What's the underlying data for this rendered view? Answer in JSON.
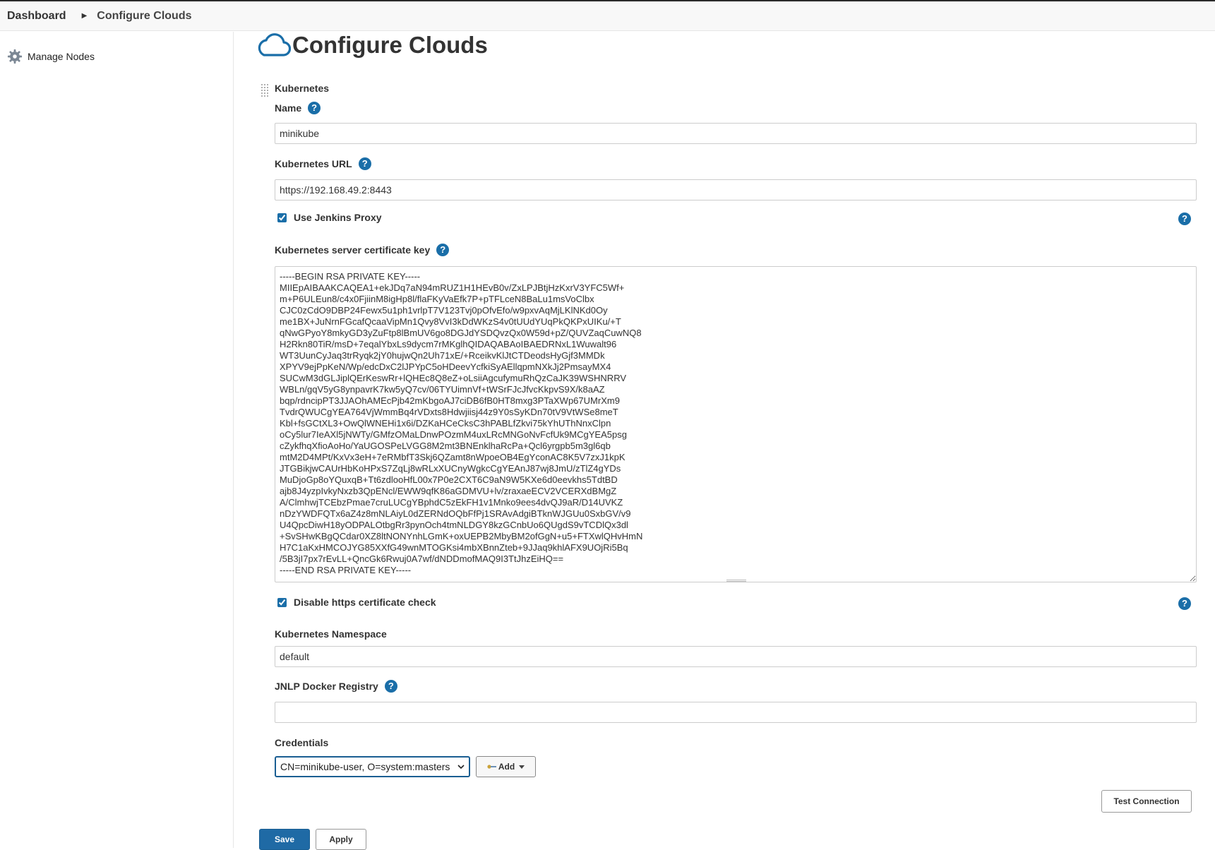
{
  "breadcrumb": {
    "items": [
      "Dashboard",
      "Configure Clouds"
    ]
  },
  "sidebar": {
    "items": [
      {
        "label": "Manage Nodes",
        "icon": "gear-icon"
      }
    ]
  },
  "page": {
    "title": "Configure Clouds",
    "icon": "cloud-icon"
  },
  "cloud": {
    "section_title": "Kubernetes",
    "name": {
      "label": "Name",
      "value": "minikube"
    },
    "url": {
      "label": "Kubernetes URL",
      "value": "https://192.168.49.2:8443"
    },
    "use_jenkins_proxy": {
      "label": "Use Jenkins Proxy",
      "checked": true
    },
    "cert_key": {
      "label": "Kubernetes server certificate key",
      "value": "-----BEGIN RSA PRIVATE KEY-----\nMIIEpAIBAAKCAQEA1+ekJDq7aN94mRUZ1H1HEvB0v/ZxLPJBtjHzKxrV3YFC5Wf+\nm+P6ULEun8/c4x0FjiinM8igHp8l/flaFKyVaEfk7P+pTFLceN8BaLu1msVoClbx\nCJC0zCdO9DBP24Fewx5u1ph1vrlpT7V123Tvj0pOfvEfo/w9pxvAqMjLKlNKd0Oy\nme1BX+JuNrnFGcafQcaaVipMn1Qvy8VvI3kDdWKzS4v0tUUdYUqPkQKPxUIKu/+T\nqNwGPyoY8mkyGD3yZuFtp8lBmUV6go8DGJdYSDQvzQx0W59d+pZ/QUVZaqCuwNQ8\nH2Rkn80TiR/msD+7eqalYbxLs9dycm7rMKglhQIDAQABAoIBAEDRNxL1Wuwalt96\nWT3UunCyJaq3trRyqk2jY0hujwQn2Uh71xE/+RceikvKlJtCTDeodsHyGjf3MMDk\nXPYV9ejPpKeN/Wp/edcDxC2lJPYpC5oHDeevYcfkiSyAEllqpmNXkJj2PmsayMX4\nSUCwM3dGLJiplQErKeswRr+lQHEc8Q8eZ+oLsiiAgcufymuRhQzCaJK39WSHNRRV\nWBLn/gqV5yG8ynpavrK7kw5yQ7cv/06TYUimnVf+tWSrFJcJfvcKkpvS9X/k8aAZ\nbqp/rdncipPT3JJAOhAMEcPjb42mKbgoAJ7ciDB6fB0HT8mxg3PTaXWp67UMrXm9\nTvdrQWUCgYEA764VjWmmBq4rVDxts8Hdwjiisj44z9Y0sSyKDn70tV9VtWSe8meT\nKbl+fsGCtXL3+OwQlWNEHi1x6i/DZKaHCeCksC3hPABLfZkvi75kYhUThNnxClpn\noCy5lur7IeAXl5jNWTy/GMfzOMaLDnwPOzmM4uxLRcMNGoNvFcfUk9MCgYEA5psg\ncZykfhqXfioAoHo/YaUGOSPeLVGG8M2mt3BNEnklhaRcPa+Qcl6yrgpb5m3gl6qb\nmtM2D4MPt/KxVx3eH+7eRMbfT3Skj6QZamt8nWpoeOB4EgYconAC8K5V7zxJ1kpK\nJTGBikjwCAUrHbKoHPxS7ZqLj8wRLxXUCnyWgkcCgYEAnJ87wj8JmU/zTlZ4gYDs\nMuDjoGp8oYQuxqB+Tt6zdlooHfL00x7P0e2CXT6C9aN9W5KXe6d0eevkhs5TdtBD\najb8J4yzpIvkyNxzb3QpENcl/EWW9qfK86aGDMVU+lv/zraxaeECV2VCERXdBMgZ\nA/ClmhwjTCEbzPmae7cruLUCgYBphdC5zEkFH1v1Mnko9ees4dvQJ9aR/D14UVKZ\nnDzYWDFQTx6aZ4z8mNLAiyL0dZERNdOQbFfPj1SRAvAdgiBTknWJGUu0SxbGV/v9\nU4QpcDiwH18yODPALOtbgRr3pynOch4tmNLDGY8kzGCnbUo6QUgdS9vTCDlQx3dl\n+SvSHwKBgQCdar0XZ8ltNONYnhLGmK+oxUEPB2MbyBM2ofGgN+u5+FTXwlQHvHmN\nH7C1aKxHMCOJYG85XXfG49wnMTOGKsi4mbXBnnZteb+9JJaq9khlAFX9UOjRi5Bq\n/5B3jI7px7rEvLL+QncGk6Rwuj0A7wf/dNDDmofMAQ9I3TtJhzEiHQ==\n-----END RSA PRIVATE KEY-----"
    },
    "disable_https_check": {
      "label": "Disable https certificate check",
      "checked": true
    },
    "namespace": {
      "label": "Kubernetes Namespace",
      "value": "default"
    },
    "jnlp_registry": {
      "label": "JNLP Docker Registry",
      "value": ""
    },
    "credentials": {
      "label": "Credentials",
      "selected": "CN=minikube-user, O=system:masters",
      "add_label": "Add"
    },
    "test_connection_label": "Test Connection"
  },
  "actions": {
    "save_label": "Save",
    "apply_label": "Apply"
  },
  "help_glyph": "?",
  "colors": {
    "accent": "#1a6ea8",
    "primary_button": "#1f6aa5"
  }
}
